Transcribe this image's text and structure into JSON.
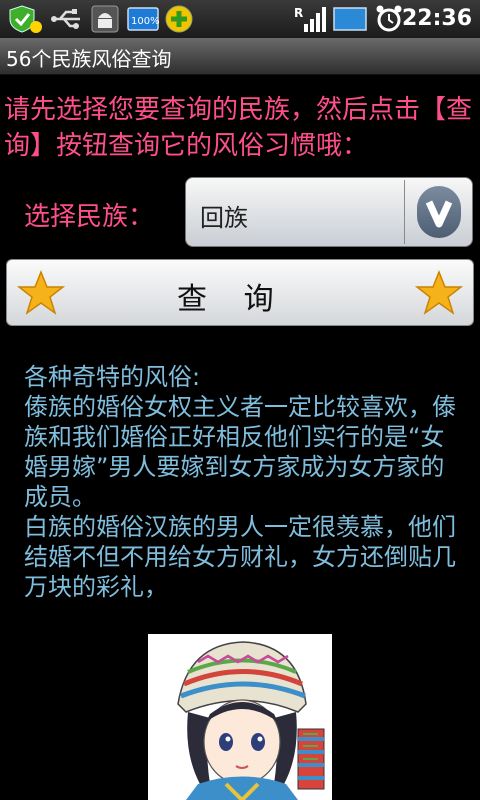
{
  "status_bar": {
    "time": "22:36",
    "battery_label": "100%",
    "icons": [
      "shield-check-icon",
      "usb-icon",
      "android-debug-icon",
      "battery-100-icon",
      "add-icon",
      "signal-icon",
      "wifi-icon",
      "alarm-icon"
    ]
  },
  "title_bar": {
    "title": "56个民族风俗查询"
  },
  "instructions": {
    "text": "请先选择您要查询的民族，然后点击【查询】按钮查询它的风俗习惯哦："
  },
  "selector": {
    "label": "选择民族：",
    "value": "回族"
  },
  "query_button": {
    "label": "查   询"
  },
  "customs": {
    "heading": "各种奇特的风俗:",
    "entries": [
      "傣族的婚俗女权主义者一定比较喜欢，傣族和我们婚俗正好相反他们实行的是“女婚男嫁”男人要嫁到女方家成为女方家的成员。",
      "白族的婚俗汉族的男人一定很羡慕，他们结婚不但不用给女方财礼，女方还倒贴几万块的彩礼，"
    ]
  },
  "colors": {
    "instruction_text": "#ff4f8b",
    "customs_text": "#7fbddd",
    "background": "#000000"
  }
}
